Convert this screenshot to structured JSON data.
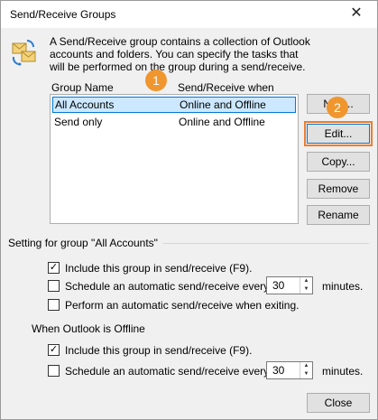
{
  "window": {
    "title": "Send/Receive Groups",
    "close_glyph": "✕"
  },
  "description": "A Send/Receive group contains a collection of Outlook accounts and folders. You can specify the tasks that will be performed on the group during a send/receive.",
  "list": {
    "columns": [
      "Group Name",
      "Send/Receive when"
    ],
    "rows": [
      {
        "name": "All Accounts",
        "when": "Online and Offline",
        "selected": true
      },
      {
        "name": "Send only",
        "when": "Online and Offline",
        "selected": false
      }
    ]
  },
  "buttons": {
    "new": "New...",
    "edit": "Edit...",
    "copy": "Copy...",
    "remove": "Remove",
    "rename": "Rename",
    "close": "Close"
  },
  "callouts": {
    "one": "1",
    "two": "2",
    "color": "#f0962e"
  },
  "settings": {
    "heading": "Setting for group \"All Accounts\"",
    "online": {
      "include": {
        "label": "Include this group in send/receive (F9).",
        "checked": true
      },
      "schedule": {
        "label": "Schedule an automatic send/receive every",
        "checked": false,
        "value": "30",
        "unit": "minutes."
      },
      "exit": {
        "label": "Perform an automatic send/receive when exiting.",
        "checked": false
      }
    },
    "offline_heading": "When Outlook is Offline",
    "offline": {
      "include": {
        "label": "Include this group in send/receive (F9).",
        "checked": true
      },
      "schedule": {
        "label": "Schedule an automatic send/receive every",
        "checked": false,
        "value": "30",
        "unit": "minutes."
      }
    }
  },
  "icons": {
    "group": "send-receive-groups-icon",
    "check": "✓"
  }
}
